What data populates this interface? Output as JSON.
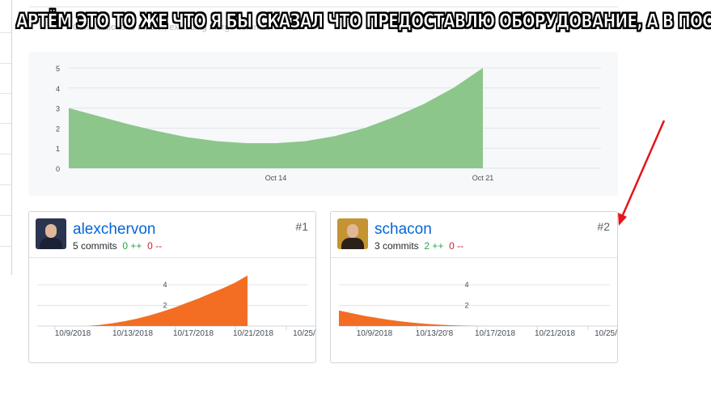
{
  "caption": "АРТЁМ ЭТО ТО ЖЕ ЧТО Я БЫ СКАЗАЛ ЧТО ПРЕДОСТАВЛЮ ОБОРУДОВАНИЕ, А В ПОС",
  "header_faded_text": "Contributions to master, excluding merge commits",
  "colors": {
    "main_area": "#8cc68a",
    "contributor_area": "#f36e22",
    "link": "#0366d6",
    "add": "#28a745",
    "del": "#cb2431",
    "arrow": "#e5141b"
  },
  "chart_data": [
    {
      "type": "area",
      "title": "",
      "x": [
        "Oct 7",
        "Oct 8",
        "Oct 9",
        "Oct 10",
        "Oct 11",
        "Oct 12",
        "Oct 13",
        "Oct 14",
        "Oct 15",
        "Oct 16",
        "Oct 17",
        "Oct 18",
        "Oct 19",
        "Oct 20",
        "Oct 21"
      ],
      "values": [
        3,
        2.6,
        2.2,
        1.85,
        1.55,
        1.35,
        1.25,
        1.25,
        1.35,
        1.6,
        2.0,
        2.55,
        3.2,
        4.0,
        5.0
      ],
      "xticks": [
        "Oct 14",
        "Oct 21"
      ],
      "yticks": [
        "0",
        "1",
        "2",
        "3",
        "4",
        "5"
      ],
      "ylim": [
        0,
        5
      ],
      "grid": true
    }
  ],
  "contributors": [
    {
      "username": "alexchervon",
      "rank": "#1",
      "commits": "5 commits",
      "additions": "0 ++",
      "deletions": "0 --",
      "chart_data": {
        "type": "area",
        "x_start": "10/6/2018",
        "x_end": "10/26/2018",
        "values": [
          0,
          0,
          0,
          0,
          0,
          0.1,
          0.25,
          0.45,
          0.7,
          1.0,
          1.35,
          1.75,
          2.2,
          2.65,
          3.15,
          3.65,
          4.2,
          4.9
        ],
        "data_end_index": 17,
        "xticks": [
          "10/9/2018",
          "10/13/2018",
          "10/17/2018",
          "10/21/2018",
          "10/25/"
        ],
        "yticks": [
          "2",
          "4"
        ],
        "ylim": [
          0,
          5.5
        ]
      }
    },
    {
      "username": "schacon",
      "rank": "#2",
      "commits": "3 commits",
      "additions": "2 ++",
      "deletions": "0 --",
      "chart_data": {
        "type": "area",
        "x_start": "10/6/2018",
        "x_end": "10/26/2018",
        "values": [
          1.5,
          1.25,
          1.0,
          0.8,
          0.6,
          0.45,
          0.32,
          0.22,
          0.14,
          0.08,
          0.04,
          0.01,
          0,
          0,
          0,
          0,
          0,
          0
        ],
        "data_end_index": 17,
        "xticks": [
          "10/9/2018",
          "10/13/20'8",
          "10/17/2018",
          "10/21/2018",
          "10/25/"
        ],
        "yticks": [
          "2",
          "4"
        ],
        "ylim": [
          0,
          5.5
        ]
      }
    }
  ]
}
